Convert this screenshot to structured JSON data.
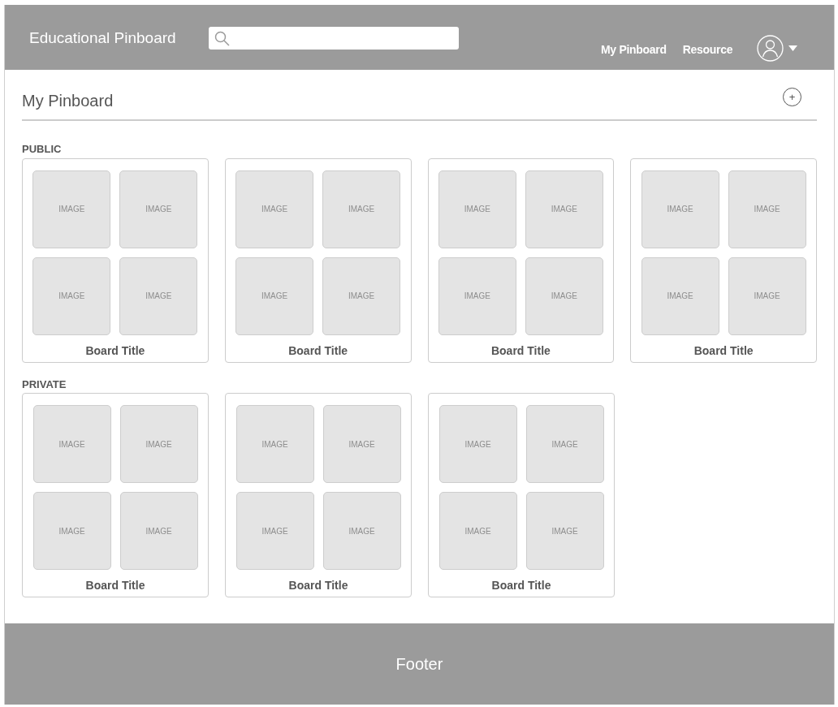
{
  "header": {
    "brand": "Educational Pinboard",
    "nav": [
      "My Pinboard",
      "Resource"
    ]
  },
  "page_title": "My Pinboard",
  "add_button": "+",
  "sections": [
    {
      "label": "PUBLIC",
      "boards": [
        {
          "title": "Board Title",
          "tiles": [
            "IMAGE",
            "IMAGE",
            "IMAGE",
            "IMAGE"
          ]
        },
        {
          "title": "Board Title",
          "tiles": [
            "IMAGE",
            "IMAGE",
            "IMAGE",
            "IMAGE"
          ]
        },
        {
          "title": "Board Title",
          "tiles": [
            "IMAGE",
            "IMAGE",
            "IMAGE",
            "IMAGE"
          ]
        },
        {
          "title": "Board Title",
          "tiles": [
            "IMAGE",
            "IMAGE",
            "IMAGE",
            "IMAGE"
          ]
        }
      ]
    },
    {
      "label": "PRIVATE",
      "boards": [
        {
          "title": "Board Title",
          "tiles": [
            "IMAGE",
            "IMAGE",
            "IMAGE",
            "IMAGE"
          ]
        },
        {
          "title": "Board Title",
          "tiles": [
            "IMAGE",
            "IMAGE",
            "IMAGE",
            "IMAGE"
          ]
        },
        {
          "title": "Board Title",
          "tiles": [
            "IMAGE",
            "IMAGE",
            "IMAGE",
            "IMAGE"
          ]
        }
      ]
    }
  ],
  "footer": "Footer"
}
